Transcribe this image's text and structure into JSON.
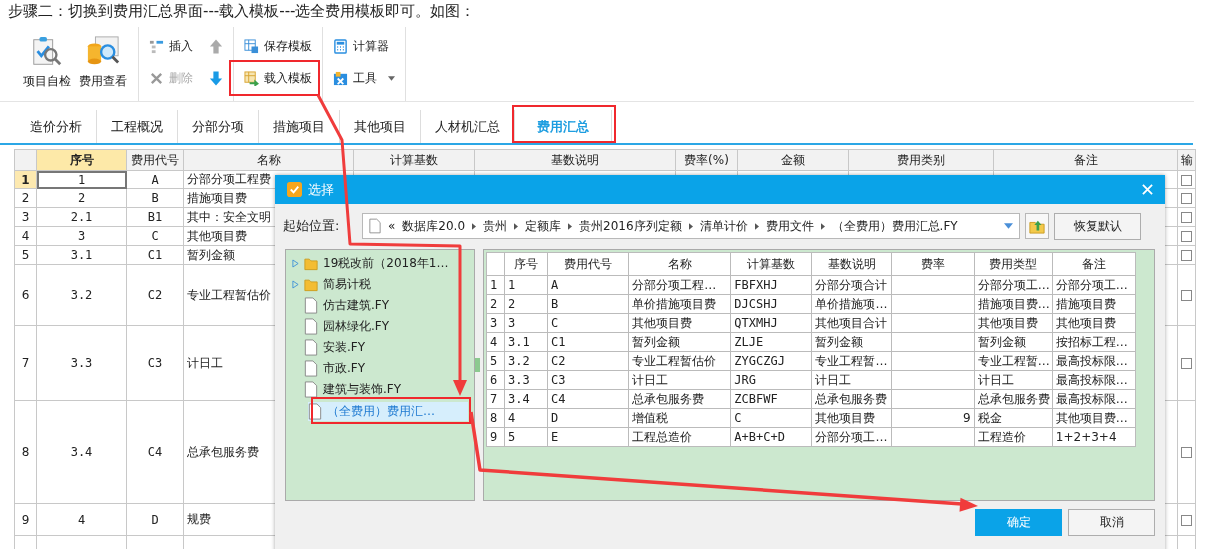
{
  "caption": "步骤二：切换到费用汇总界面---载入模板---选全费用模板即可。如图：",
  "toolbar": {
    "large": [
      {
        "label": "项目自检",
        "kind": "check"
      },
      {
        "label": "费用查看",
        "kind": "view"
      }
    ],
    "edit": [
      {
        "label": "插入",
        "kind": "insert",
        "disabled": false
      },
      {
        "label": "删除",
        "kind": "delete",
        "disabled": true
      }
    ],
    "move": [
      {
        "kind": "up",
        "disabled": true
      },
      {
        "kind": "down",
        "disabled": false
      }
    ],
    "template": [
      {
        "label": "保存模板",
        "kind": "save"
      },
      {
        "label": "载入模板",
        "kind": "load"
      }
    ],
    "tools": [
      {
        "label": "计算器",
        "kind": "calculator",
        "dropdown": false
      },
      {
        "label": "工具",
        "kind": "tool",
        "dropdown": true
      }
    ]
  },
  "tabs": [
    {
      "label": "造价分析",
      "selected": false
    },
    {
      "label": "工程概况",
      "selected": false
    },
    {
      "label": "分部分项",
      "selected": false
    },
    {
      "label": "措施项目",
      "selected": false
    },
    {
      "label": "其他项目",
      "selected": false
    },
    {
      "label": "人材机汇总",
      "selected": false
    },
    {
      "label": "费用汇总",
      "selected": true
    }
  ],
  "grid": {
    "columns": [
      {
        "label": "序号",
        "selected": true
      },
      {
        "label": "费用代号",
        "selected": false
      },
      {
        "label": "名称",
        "selected": false
      },
      {
        "label": "计算基数",
        "selected": false
      },
      {
        "label": "基数说明",
        "selected": false
      },
      {
        "label": "费率(%)",
        "selected": false
      },
      {
        "label": "金额",
        "selected": false
      },
      {
        "label": "费用类别",
        "selected": false
      },
      {
        "label": "备注",
        "selected": false
      },
      {
        "label": "输",
        "selected": false
      }
    ],
    "rows": [
      {
        "no": "1",
        "seq": "1",
        "code": "A",
        "name": "分部分项工程费",
        "selected": true,
        "checked": false
      },
      {
        "no": "2",
        "seq": "2",
        "code": "B",
        "name": "措施项目费",
        "selected": false,
        "checked": false
      },
      {
        "no": "3",
        "seq": "2.1",
        "code": "B1",
        "name": "其中：安全文明",
        "selected": false,
        "checked": false
      },
      {
        "no": "4",
        "seq": "3",
        "code": "C",
        "name": "其他项目费",
        "selected": false,
        "checked": false
      },
      {
        "no": "5",
        "seq": "3.1",
        "code": "C1",
        "name": "暂列金额",
        "selected": false,
        "checked": false
      },
      {
        "no": "6",
        "seq": "3.2",
        "code": "C2",
        "name": "专业工程暂估价",
        "selected": false,
        "checked": false
      },
      {
        "no": "7",
        "seq": "3.3",
        "code": "C3",
        "name": "计日工",
        "selected": false,
        "checked": false
      },
      {
        "no": "8",
        "seq": "3.4",
        "code": "C4",
        "name": "总承包服务费",
        "selected": false,
        "checked": false
      },
      {
        "no": "9",
        "seq": "4",
        "code": "D",
        "name": "规费",
        "selected": false,
        "checked": false
      }
    ]
  },
  "dialog": {
    "title": "选择",
    "path_label": "起始位置:",
    "path_back": "«",
    "path": [
      "数据库20.0",
      "贵州",
      "定额库",
      "贵州2016序列定额",
      "清单计价",
      "费用文件",
      "（全费用）费用汇总.FY"
    ],
    "reset_button": "恢复默认",
    "tree": [
      {
        "label": "19税改前（2018年1…",
        "kind": "folder",
        "expanded": false,
        "selected": false
      },
      {
        "label": "简易计税",
        "kind": "folder",
        "expanded": false,
        "selected": false
      },
      {
        "label": "仿古建筑.FY",
        "kind": "file",
        "selected": false
      },
      {
        "label": "园林绿化.FY",
        "kind": "file",
        "selected": false
      },
      {
        "label": "安装.FY",
        "kind": "file",
        "selected": false
      },
      {
        "label": "市政.FY",
        "kind": "file",
        "selected": false
      },
      {
        "label": "建筑与装饰.FY",
        "kind": "file",
        "selected": false
      },
      {
        "label": "（全费用）费用汇…",
        "kind": "file",
        "selected": true
      }
    ],
    "table": {
      "columns": [
        "序号",
        "费用代号",
        "名称",
        "计算基数",
        "基数说明",
        "费率",
        "费用类型",
        "备注"
      ],
      "rows": [
        {
          "no": "1",
          "seq": "1",
          "code": "A",
          "name": "分部分项工程…",
          "base": "FBFXHJ",
          "base_desc": "分部分项合计",
          "type": "分部分项工…",
          "note": "分部分项工…"
        },
        {
          "no": "2",
          "seq": "2",
          "code": "B",
          "name": "单价措施项目费",
          "base": "DJCSHJ",
          "base_desc": "单价措施项…",
          "type": "措施项目费…",
          "note": "措施项目费"
        },
        {
          "no": "3",
          "seq": "3",
          "code": "C",
          "name": "其他项目费",
          "base": "QTXMHJ",
          "base_desc": "其他项目合计",
          "type": "其他项目费",
          "note": "其他项目费"
        },
        {
          "no": "4",
          "seq": "3.1",
          "code": "C1",
          "name": "暂列金额",
          "base": "ZLJE",
          "base_desc": "暂列金额",
          "type": "暂列金额",
          "note": "按招标工程…"
        },
        {
          "no": "5",
          "seq": "3.2",
          "code": "C2",
          "name": "专业工程暂估价",
          "base": "ZYGCZGJ",
          "base_desc": "专业工程暂…",
          "type": "专业工程暂…",
          "note": "最高投标限…"
        },
        {
          "no": "6",
          "seq": "3.3",
          "code": "C3",
          "name": "计日工",
          "base": "JRG",
          "base_desc": "计日工",
          "type": "计日工",
          "note": "最高投标限…"
        },
        {
          "no": "7",
          "seq": "3.4",
          "code": "C4",
          "name": "总承包服务费",
          "base": "ZCBFWF",
          "base_desc": "总承包服务费",
          "type": "总承包服务费",
          "note": "最高投标限…"
        },
        {
          "no": "8",
          "seq": "4",
          "code": "D",
          "name": "增值税",
          "base": "C",
          "base_desc": "其他项目费",
          "rate": "9",
          "type": "税金",
          "note": "其他项目费…"
        },
        {
          "no": "9",
          "seq": "5",
          "code": "E",
          "name": "工程总造价",
          "base": "A+B+C+D",
          "base_desc": "分部分项工…",
          "type": "工程造价",
          "note": "1+2+3+4"
        }
      ]
    },
    "buttons": [
      {
        "label": "确定",
        "kind": "primary"
      },
      {
        "label": "取消",
        "kind": "secondary"
      }
    ]
  }
}
